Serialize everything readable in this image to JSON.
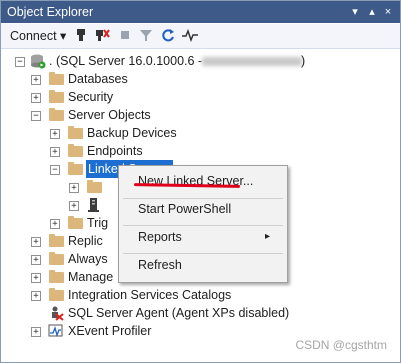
{
  "window": {
    "title": "Object Explorer",
    "pin_glyph": "↓",
    "pin2_glyph": "2",
    "close_glyph": "×"
  },
  "toolbar": {
    "connect_label": "Connect",
    "connect_arrow": "▾",
    "icons": [
      "connect-icon",
      "disconnect-icon",
      "stop-icon",
      "filter-icon",
      "refresh-icon",
      "activity-icon"
    ]
  },
  "tree": {
    "server_label": ". (SQL Server 16.0.1000.6 - ",
    "server_suffix": ")",
    "items": {
      "databases": "Databases",
      "security": "Security",
      "server_objects": "Server Objects",
      "backup_devices": "Backup Devices",
      "endpoints": "Endpoints",
      "linked_servers": "Linked Servers",
      "triggers": "Trig",
      "replication": "Replic",
      "always_on": "Always",
      "management": "Manage",
      "integration_services": "Integration Services Catalogs",
      "sql_agent": "SQL Server Agent (Agent XPs disabled)",
      "xevent": "XEvent Profiler"
    }
  },
  "context_menu": {
    "items": [
      {
        "label": "New Linked Server..."
      },
      {
        "label": "Start PowerShell"
      },
      {
        "label": "Reports",
        "submenu": "▸"
      },
      {
        "label": "Refresh"
      }
    ]
  },
  "watermark": "CSDN @cgsthtm"
}
